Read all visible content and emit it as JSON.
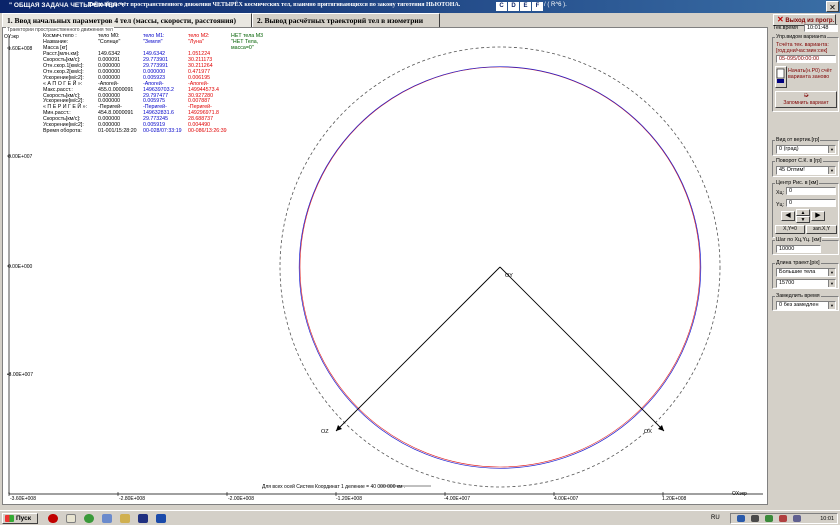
{
  "window": {
    "title_short": "\" ОБЩАЯ ЗАДАЧА ЧЕТЫРЁХ ТЕЛ \":",
    "title_long": "Точный расчёт пространственного движения ЧЕТЫРЁХ космических тел, взаимно притягивающихся по закону тяготения НЬЮТОНА.",
    "title_suffix": "/ ( R^6 ).",
    "ctrl_letters": [
      "C",
      "D",
      "E",
      "F"
    ],
    "close_glyph": "✕"
  },
  "tabs": [
    {
      "label": "1. Ввод начальных параметров 4 тел (массы, скорости, расстояния)"
    },
    {
      "label": "2. Вывод расчётных траекторий тел в изометрии"
    }
  ],
  "exit_button": {
    "icon_glyph": "✕",
    "label": "Выход из прогр."
  },
  "plot": {
    "group_label": "Траектории пространственного движения тел",
    "y_axis_name": "OYэкр",
    "x_axis_name": "OXэкр",
    "y_ticks": [
      "1.60E+008",
      "8.00E+007",
      "0.00E+000",
      "-8.00E+007"
    ],
    "x_ticks": [
      "-3.60E+008",
      "-2.80E+008",
      "-2.00E+008",
      "-1.20E+008",
      "-4.00E+007",
      "4.00E+007",
      "1.20E+008"
    ],
    "axis_labels": {
      "oy": "OY",
      "oz": "OZ",
      "ox": "OX"
    },
    "scale_note": "Для всех осей Систем Координат  1 деление  = 40 000 000 км ."
  },
  "info": {
    "headers": [
      {
        "text": "тело М0:",
        "color": "blk"
      },
      {
        "text": "тело М1:",
        "color": "blu"
      },
      {
        "text": "тело М2:",
        "color": "red"
      },
      {
        "text": "НЕТ тела М3",
        "color": "grn"
      }
    ],
    "rows": [
      {
        "label": "Космич.тело :",
        "v0": "",
        "v1": "",
        "v2": "",
        "v3": ""
      },
      {
        "label": "Название:",
        "v0": "\"Солнце\"",
        "v1": "\"Земля\"",
        "v2": "\"Луна\"",
        "v3": "\"НЕТ Тела,"
      },
      {
        "label": "Масса [кг]",
        "v0": "",
        "v1": "",
        "v2": "",
        "v3": "масса=0\""
      },
      {
        "label": "Расст.[млн.км]:",
        "v0": "149.6342",
        "v1": "149.6342",
        "v2": "1.051224",
        "v3": ""
      },
      {
        "label": "Скорость[км/с]:",
        "v0": "0.000091",
        "v1": "29.773901",
        "v2": "30.211173",
        "v3": ""
      },
      {
        "label": "Отн.скор.1[км/с]:",
        "v0": "0.000000",
        "v1": "29.773991",
        "v2": "30.211264",
        "v3": ""
      },
      {
        "label": "Отн.скор.2[км/с]:",
        "v0": "0.000000",
        "v1": "0.000000",
        "v2": "0.471977",
        "v3": ""
      },
      {
        "label": "Ускорение[м/с2]:",
        "v0": "0.000000",
        "v1": "0.005923",
        "v2": "0.006195",
        "v3": ""
      },
      {
        "label": "« А П О Г Е Й »:",
        "v0": "-Апогей-",
        "v1": "-Апогей-",
        "v2": "-Апогей-",
        "v3": ""
      },
      {
        "label": "Макс.расст.:",
        "v0": "455.0.0000091",
        "v1": "149639703.2",
        "v2": "149944573.4",
        "v3": ""
      },
      {
        "label": "Скорость[км/с]:",
        "v0": "0.000000",
        "v1": "29.797477",
        "v2": "30.927280",
        "v3": ""
      },
      {
        "label": "Ускорение[м/с2]:",
        "v0": "0.000000",
        "v1": "0.005975",
        "v2": "0.007887",
        "v3": ""
      },
      {
        "label": "« П Е Р И Г Е Й »:",
        "v0": "-Перигей-",
        "v1": "-Перигей-",
        "v2": "-Перигей-",
        "v3": ""
      },
      {
        "label": "Мин.расст.:",
        "v0": "454.8.0000091",
        "v1": "149632831.6",
        "v2": "149296971.8",
        "v3": ""
      },
      {
        "label": "Скорость[км/с]:",
        "v0": "0.000000",
        "v1": "29.773245",
        "v2": "28.688737",
        "v3": ""
      },
      {
        "label": "Ускорение[м/с2]:",
        "v0": "0.000000",
        "v1": "0.005919",
        "v2": "0.004490",
        "v3": ""
      },
      {
        "label": "Время оборота:",
        "v0": "01-001/15:28:20",
        "v1": "00-028/07:33:19",
        "v2": "00-086/13:26:39",
        "v3": ""
      }
    ]
  },
  "right_panel": {
    "time_label": "Тек.время",
    "time_value": "10:01:48",
    "mgmt_title": "Упр.видом варианта",
    "count_label": "Тсчёта тек. варианта:",
    "count_format": "[год:дни/час:мин:сек]",
    "count_value": "05-095/00:00:00",
    "restart_label": "Начать(н.Р0) счёт варианта заново",
    "save_label": "Запомнить вариант",
    "view_group": "Вид от вертик.[гр]",
    "view_value": "0  (град)",
    "rot_group": "Поворот С.К. в [гр]",
    "rot_value": "45 Оптим!",
    "center_group": "Центр Рис. в [км]",
    "xc_label": "Хц:",
    "xc_value": "0",
    "yc_label": "Yц:",
    "yc_value": "0",
    "reset_label": "X,Y=0",
    "save_xy_label": "зап.X,Y",
    "step_group": "Шаг по Хц,Yц. [км]",
    "step_value": "10000",
    "len_group": "Длина траект.[pix]",
    "len_value1": "Большие тела",
    "len_value2": "15700",
    "slow_group": "Замедлить время",
    "slow_value": "0 без замедлен"
  },
  "taskbar": {
    "start_label": "Пуск",
    "lang": "RU",
    "clock": "10:01"
  },
  "colors": {
    "earth": "#2020d0",
    "moon": "#e02020",
    "axis": "#000000"
  }
}
